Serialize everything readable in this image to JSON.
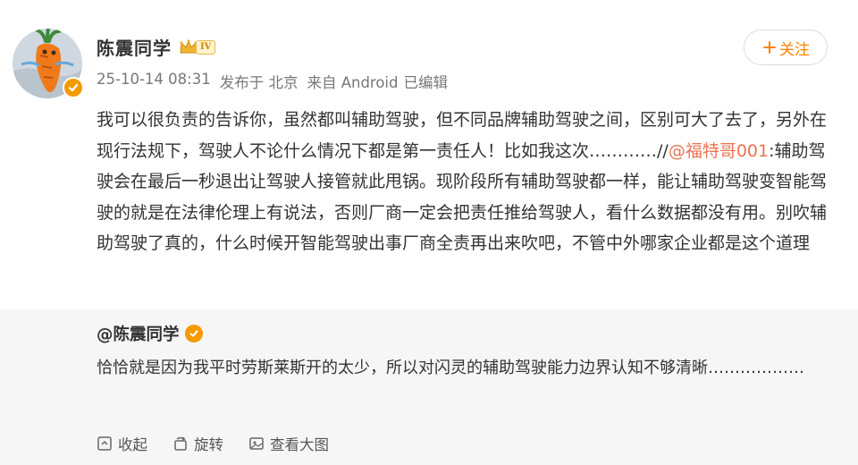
{
  "post": {
    "author_name": "陈震同学",
    "level_badge": "IV",
    "timestamp": "25-10-14 08:31",
    "published_from_label": "发布于 北京",
    "source_label": "来自 Android",
    "edited_label": "已编辑",
    "follow_label": "关注",
    "text_part1": "我可以很负责的告诉你，虽然都叫辅助驾驶，但不同品牌辅助驾驶之间，区别可大了去了，另外在现行法规下，驾驶人不论什么情况下都是第一责任人！比如我这次…………//",
    "mention": "@福特哥001",
    "text_part2": ":辅助驾驶会在最后一秒退出让驾驶人接管就此甩锅。现阶段所有辅助驾驶都一样，能让辅助驾驶变智能驾驶的就是在法律伦理上有说法，否则厂商一定会把责任推给驾驶人，看什么数据都没有用。别吹辅助驾驶了真的，什么时候开智能驾驶出事厂商全责再出来吹吧，不管中外哪家企业都是这个道理"
  },
  "repost": {
    "author": "@陈震同学",
    "text": "恰恰就是因为我平时劳斯莱斯开的太少，所以对闪灵的辅助驾驶能力边界认知不够清晰………………",
    "actions": [
      {
        "label": "收起",
        "icon": "collapse-icon"
      },
      {
        "label": "旋转",
        "icon": "rotate-icon"
      },
      {
        "label": "查看大图",
        "icon": "view-large-image-icon"
      }
    ]
  },
  "colors": {
    "accent_orange": "#ff8200",
    "mention": "#eb7350",
    "verify_badge": "#f59a00",
    "repost_bg": "#f6f6f6"
  }
}
